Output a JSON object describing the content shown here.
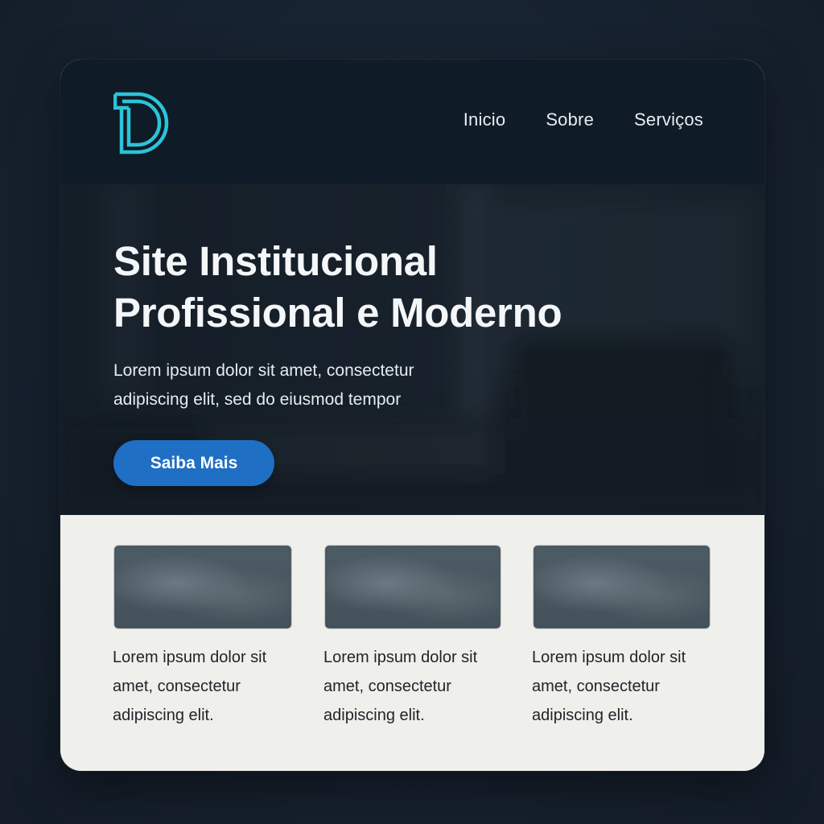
{
  "brand": {
    "logo_icon": "d-monogram-logo-icon",
    "logo_color": "#2bc4d8"
  },
  "nav": {
    "items": [
      {
        "label": "Inicio"
      },
      {
        "label": "Sobre"
      },
      {
        "label": "Serviços"
      }
    ]
  },
  "hero": {
    "title_line1": "Site Institucional",
    "title_line2": "Profissional e Moderno",
    "subtitle_line1": "Lorem ipsum dolor sit amet, consectetur",
    "subtitle_line2": "adipiscing elit, sed do eiusmod tempor",
    "cta_label": "Saiba Mais",
    "cta_color": "#1f6fc4"
  },
  "features": [
    {
      "line1": "Lorem ipsum dolor sit",
      "line2": "amet, consectetur",
      "line3": "adipiscing elit."
    },
    {
      "line1": "Lorem ipsum dolor sit",
      "line2": "amet, consectetur",
      "line3": "adipiscing elit."
    },
    {
      "line1": "Lorem ipsum dolor sit",
      "line2": "amet, consectetur",
      "line3": "adipiscing elit."
    }
  ]
}
